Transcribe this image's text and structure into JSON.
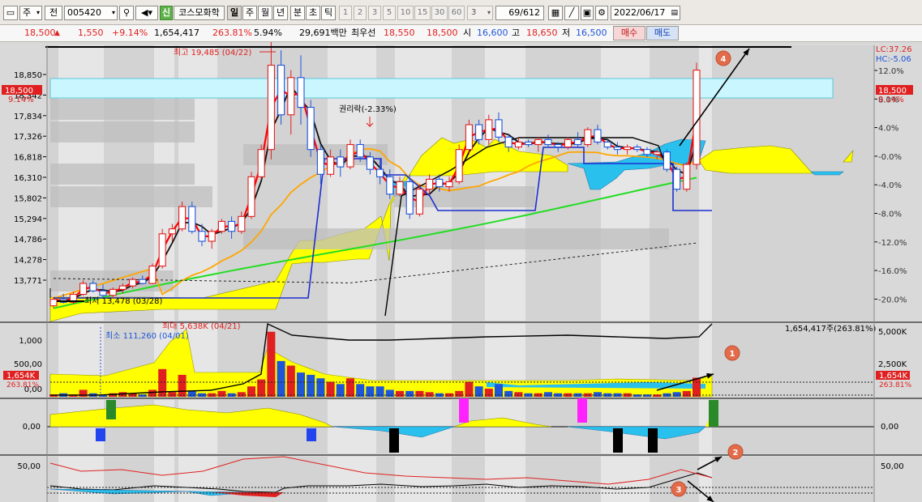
{
  "toolbar": {
    "market": "주",
    "scope": "전",
    "code": "005420",
    "badge": "신",
    "name": "코스모화학",
    "periods": [
      "일",
      "주",
      "월",
      "년",
      "분",
      "초",
      "틱"
    ],
    "active_period": "일",
    "intervals": [
      "1",
      "2",
      "3",
      "5",
      "10",
      "15",
      "30",
      "60"
    ],
    "interval_value": "3",
    "page": "69",
    "page_total": "/612",
    "date": "2022/06/17"
  },
  "quote": {
    "price": "18,500",
    "change": "1,550",
    "change_pct": "+9.14%",
    "volume": "1,654,417",
    "volume_ratio": "263.81%",
    "turnover": "5.94%",
    "amount": "29,691백만",
    "best_label": "최우선",
    "best_ask": "18,550",
    "best_bid": "18,500",
    "open_label": "시",
    "open": "16,600",
    "high_label": "고",
    "high": "18,650",
    "low_label": "저",
    "low": "16,500",
    "buy_label": "매수",
    "sell_label": "매도"
  },
  "colors": {
    "up": "#e02020",
    "down": "#1f55d8",
    "ichimoku_bull": "#ffff00",
    "ichimoku_bear": "#2ac0ee",
    "ma5": "#ff0000",
    "ma20": "#000000",
    "ma60": "#ffa500",
    "ma120": "#22dd22"
  },
  "chart": {
    "price_axis": [
      "18,850",
      "18,342",
      "17,834",
      "17,326",
      "16,818",
      "16,310",
      "15,802",
      "15,294",
      "14,786",
      "14,278",
      "13,771"
    ],
    "pct_axis": [
      "12.0%",
      "8.0%",
      "4.0%",
      "-0.0%",
      "-4.0%",
      "-8.0%",
      "-12.0%",
      "-16.0%",
      "-20.0%"
    ],
    "lc": "LC:37.26",
    "hc": "HC:-5.06",
    "last_price": "18,500",
    "last_pct": "9.14%",
    "last_price_left": "18,500",
    "last_pct_left": "9.14%",
    "high_note": "최고 19,485 (04/22)",
    "low_note": "최저 13,478 (03/28)",
    "rights_note": "권리락(-2.33%)"
  },
  "volume_panel": {
    "axis_left": [
      "1,000",
      "500,00",
      "0,00"
    ],
    "axis_right": [
      "5,000K",
      "2,500K"
    ],
    "max_note": "최대 5,638K (04/21)",
    "min_note": "최소 111,260 (04/01)",
    "total": "1,654,417주(263.81%)",
    "last_right": "1,654K",
    "last_right_pct": "263.81%",
    "last_left": "1,654K",
    "last_left_pct": "263.81%"
  },
  "osc_panel": {
    "axis_left": "0,00",
    "axis_right": "0,00"
  },
  "rsi_panel": {
    "axis_left": "50,00",
    "axis_right": "50,00"
  },
  "annotations": [
    "1",
    "2",
    "3",
    "4"
  ],
  "candles": [
    [
      13750,
      13920,
      13700,
      13880
    ],
    [
      13880,
      13990,
      13800,
      13820
    ],
    [
      13820,
      14030,
      13780,
      13980
    ],
    [
      13980,
      14260,
      13950,
      14200
    ],
    [
      14200,
      14260,
      14020,
      14050
    ],
    [
      14050,
      14180,
      13920,
      13960
    ],
    [
      13960,
      14120,
      13900,
      14080
    ],
    [
      14080,
      14200,
      14000,
      14150
    ],
    [
      14150,
      14320,
      14100,
      14280
    ],
    [
      14280,
      14360,
      14180,
      14200
    ],
    [
      14200,
      14600,
      14180,
      14550
    ],
    [
      14550,
      15300,
      14500,
      15200
    ],
    [
      15200,
      15400,
      15050,
      15300
    ],
    [
      15300,
      15850,
      15250,
      15750
    ],
    [
      15750,
      15850,
      15200,
      15250
    ],
    [
      15250,
      15400,
      14950,
      15050
    ],
    [
      15050,
      15300,
      14900,
      15250
    ],
    [
      15250,
      15500,
      15200,
      15450
    ],
    [
      15450,
      15550,
      15100,
      15250
    ],
    [
      15250,
      15650,
      15200,
      15550
    ],
    [
      15550,
      16450,
      15500,
      16350
    ],
    [
      16350,
      17000,
      16300,
      16900
    ],
    [
      16900,
      19485,
      16700,
      18600
    ],
    [
      18600,
      18900,
      17400,
      17600
    ],
    [
      17600,
      18500,
      17200,
      18350
    ],
    [
      18350,
      18800,
      17400,
      17750
    ],
    [
      17750,
      17900,
      16750,
      16900
    ],
    [
      16900,
      17000,
      16200,
      16400
    ],
    [
      16400,
      16900,
      16350,
      16750
    ],
    [
      16750,
      16900,
      16350,
      16550
    ],
    [
      16550,
      17100,
      16500,
      17000
    ],
    [
      17000,
      17100,
      16650,
      16750
    ],
    [
      16750,
      16850,
      16400,
      16500
    ],
    [
      16500,
      16700,
      16200,
      16350
    ],
    [
      16350,
      16500,
      15900,
      16000
    ],
    [
      16000,
      16350,
      15950,
      16250
    ],
    [
      16250,
      16400,
      15500,
      15600
    ],
    [
      15600,
      16200,
      15550,
      16100
    ],
    [
      16100,
      16400,
      16000,
      16300
    ],
    [
      16300,
      16400,
      16050,
      16150
    ],
    [
      16150,
      16350,
      16050,
      16250
    ],
    [
      16250,
      17000,
      16200,
      16900
    ],
    [
      16900,
      17500,
      16800,
      17400
    ],
    [
      17400,
      17500,
      17000,
      17100
    ],
    [
      17100,
      17600,
      17000,
      17500
    ],
    [
      17500,
      17650,
      17050,
      17150
    ],
    [
      17150,
      17200,
      16850,
      16950
    ],
    [
      16950,
      17150,
      16900,
      17050
    ],
    [
      17050,
      17100,
      16950,
      17000
    ],
    [
      17000,
      17150,
      16850,
      17100
    ],
    [
      17100,
      17200,
      16950,
      17000
    ],
    [
      17000,
      17050,
      16850,
      16950
    ],
    [
      16950,
      17150,
      16900,
      17100
    ],
    [
      17100,
      17250,
      16950,
      17000
    ],
    [
      17000,
      17350,
      16950,
      17300
    ],
    [
      17300,
      17400,
      17000,
      17050
    ],
    [
      17050,
      17100,
      16900,
      16950
    ],
    [
      16950,
      17050,
      16800,
      16900
    ],
    [
      16900,
      17000,
      16800,
      16950
    ],
    [
      16950,
      17000,
      16850,
      16900
    ],
    [
      16900,
      16950,
      16750,
      16800
    ],
    [
      16800,
      16900,
      16700,
      16850
    ],
    [
      16850,
      16900,
      16450,
      16500
    ],
    [
      16500,
      16550,
      16050,
      16100
    ],
    [
      16100,
      16650,
      16050,
      16600
    ],
    [
      16600,
      18650,
      16500,
      18500
    ]
  ],
  "volumes": [
    0.2,
    0.3,
    0.2,
    0.6,
    0.3,
    0.2,
    0.3,
    0.4,
    0.3,
    0.2,
    0.6,
    2.4,
    0.4,
    1.9,
    0.5,
    0.3,
    0.3,
    0.5,
    0.3,
    0.4,
    0.9,
    1.5,
    5.638,
    3.1,
    2.7,
    2.1,
    1.9,
    1.6,
    1.3,
    1.1,
    1.6,
    1.1,
    0.9,
    0.9,
    0.6,
    0.5,
    0.5,
    0.5,
    0.4,
    0.3,
    0.3,
    0.5,
    1.3,
    0.9,
    0.7,
    1.1,
    0.5,
    0.4,
    0.3,
    0.3,
    0.4,
    0.3,
    0.3,
    0.3,
    0.3,
    0.4,
    0.3,
    0.3,
    0.3,
    0.2,
    0.2,
    0.2,
    0.3,
    0.4,
    0.5,
    1.654
  ]
}
